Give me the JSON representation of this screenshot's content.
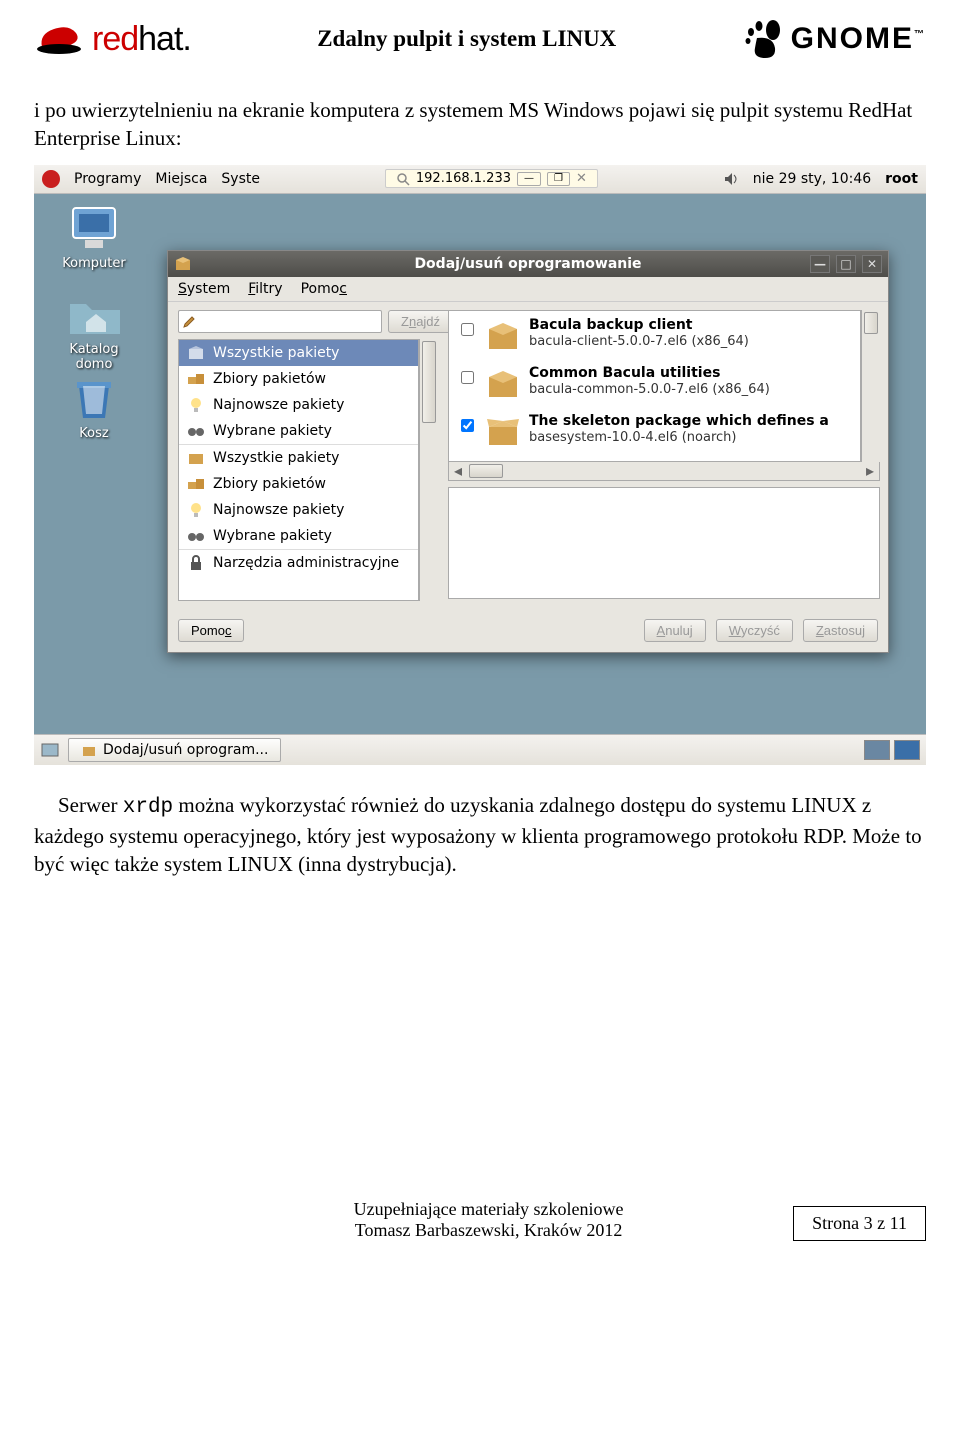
{
  "header": {
    "redhat_red": "red",
    "redhat_hat": "hat.",
    "title": "Zdalny pulpit i system LINUX",
    "gnome": "GNOME",
    "tm": "™"
  },
  "para1": "i po uwierzytelnieniu na ekranie komputera z systemem MS Windows pojawi się pulpit systemu RedHat Enterprise Linux:",
  "para2a": "Serwer ",
  "para2_mono": "xrdp",
  "para2b": " można wykorzystać również do uzyskania zdalnego dostępu do systemu LINUX z każdego systemu operacyjnego, który jest wyposażony w klienta programowego protokołu RDP. Może to być więc także system LINUX (inna dystrybucja).",
  "topbar": {
    "programs": "Programy",
    "places": "Miejsca",
    "system": "Syste",
    "ip": "192.168.1.233",
    "date": "nie 29 sty, 10:46",
    "user": "root"
  },
  "desktop": {
    "computer": "Komputer",
    "home": "Katalog domo",
    "trash": "Kosz"
  },
  "window": {
    "title": "Dodaj/usuń oprogramowanie",
    "menu": {
      "system": "System",
      "filters": "Filtry",
      "help": "Pomoc"
    },
    "search_btn": "Znajdź",
    "categories": [
      "Wszystkie pakiety",
      "Zbiory pakietów",
      "Najnowsze pakiety",
      "Wybrane pakiety",
      "Wszystkie pakiety",
      "Zbiory pakietów",
      "Najnowsze pakiety",
      "Wybrane pakiety",
      "Narzędzia administracyjne"
    ],
    "packages": [
      {
        "checked": false,
        "name": "Bacula backup client",
        "ver": "bacula-client-5.0.0-7.el6 (x86_64)"
      },
      {
        "checked": false,
        "name": "Common Bacula utilities",
        "ver": "bacula-common-5.0.0-7.el6 (x86_64)"
      },
      {
        "checked": true,
        "name": "The skeleton package which defines a",
        "ver": "basesystem-10.0-4.el6 (noarch)"
      }
    ],
    "buttons": {
      "help": "Pomoc",
      "cancel": "Anuluj",
      "clear": "Wyczyść",
      "apply": "Zastosuj"
    }
  },
  "taskbar": {
    "app": "Dodaj/usuń oprogram..."
  },
  "footer": {
    "line1": "Uzupełniające materiały szkoleniowe",
    "line2": "Tomasz Barbaszewski, Kraków 2012",
    "page": "Strona 3 z 11"
  }
}
